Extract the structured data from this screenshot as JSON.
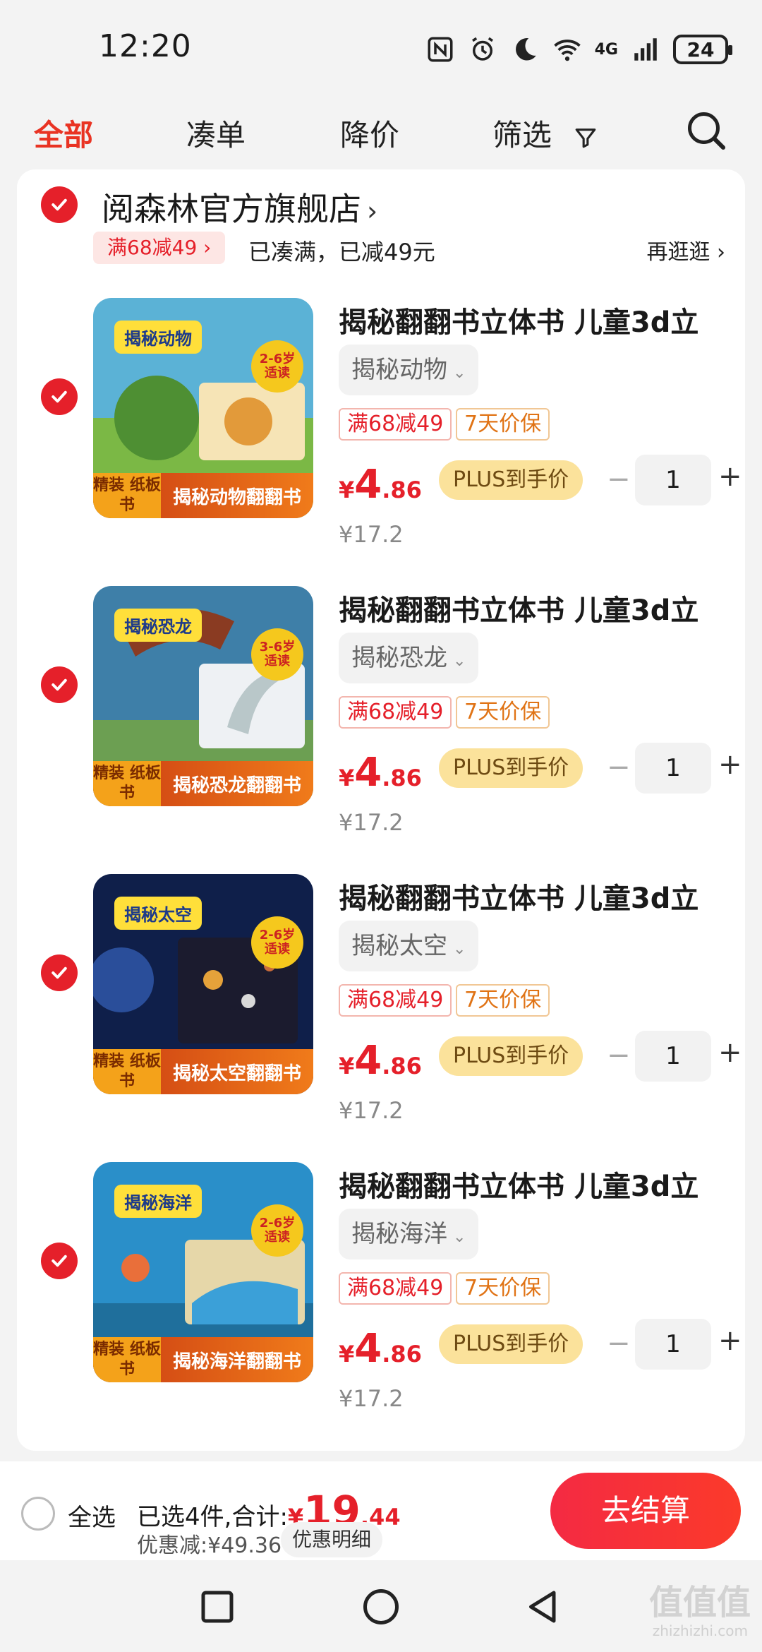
{
  "status_bar": {
    "time": "12:20",
    "network": "4G",
    "battery": "24"
  },
  "tabs": [
    {
      "label": "全部",
      "active": true
    },
    {
      "label": "凑单",
      "active": false
    },
    {
      "label": "降价",
      "active": false
    },
    {
      "label": "筛选",
      "active": false
    }
  ],
  "shop": {
    "name": "阅森林官方旗舰店",
    "promo_tag": "满68减49 ›",
    "promo_text": "已凑满，已减49元",
    "promo_more": "再逛逛 ›"
  },
  "items": [
    {
      "title": "揭秘翻翻书立体书 儿童3d立",
      "spec": "揭秘动物",
      "tag1": "满68减49",
      "tag2": "7天价保",
      "price_currency": "¥",
      "price_int": "4",
      "price_dec": ".86",
      "plus_label": "PLUS到手价",
      "quantity": "1",
      "original_price": "¥17.2",
      "thumb_title": "揭秘动物",
      "thumb_banner": "揭秘动物翻翻书",
      "thumb_badge": "精装 纸板书",
      "thumb_age": "2-6岁 适读",
      "thumb_color_bg": "#5bb2d6",
      "thumb_color_fg": "#4e8f33"
    },
    {
      "title": "揭秘翻翻书立体书 儿童3d立",
      "spec": "揭秘恐龙",
      "tag1": "满68减49",
      "tag2": "7天价保",
      "price_currency": "¥",
      "price_int": "4",
      "price_dec": ".86",
      "plus_label": "PLUS到手价",
      "quantity": "1",
      "original_price": "¥17.2",
      "thumb_title": "揭秘恐龙",
      "thumb_banner": "揭秘恐龙翻翻书",
      "thumb_badge": "精装 纸板书",
      "thumb_age": "3-6岁 适读",
      "thumb_color_bg": "#3e7fa8",
      "thumb_color_fg": "#8a3b22"
    },
    {
      "title": "揭秘翻翻书立体书 儿童3d立",
      "spec": "揭秘太空",
      "tag1": "满68减49",
      "tag2": "7天价保",
      "price_currency": "¥",
      "price_int": "4",
      "price_dec": ".86",
      "plus_label": "PLUS到手价",
      "quantity": "1",
      "original_price": "¥17.2",
      "thumb_title": "揭秘太空",
      "thumb_banner": "揭秘太空翻翻书",
      "thumb_badge": "精装 纸板书",
      "thumb_age": "2-6岁 适读",
      "thumb_color_bg": "#0f1f4a",
      "thumb_color_fg": "#2a4e9a"
    },
    {
      "title": "揭秘翻翻书立体书 儿童3d立",
      "spec": "揭秘海洋",
      "tag1": "满68减49",
      "tag2": "7天价保",
      "price_currency": "¥",
      "price_int": "4",
      "price_dec": ".86",
      "plus_label": "PLUS到手价",
      "quantity": "1",
      "original_price": "¥17.2",
      "thumb_title": "揭秘海洋",
      "thumb_banner": "揭秘海洋翻翻书",
      "thumb_badge": "精装 纸板书",
      "thumb_age": "2-6岁 适读",
      "thumb_color_bg": "#2a8fc9",
      "thumb_color_fg": "#e6d7a9"
    }
  ],
  "checkout": {
    "select_all": "全选",
    "summary": "已选4件,合计:",
    "total_currency": "¥",
    "total_int": "19",
    "total_dec": ".44",
    "discount": "优惠减:¥49.36",
    "detail_button": "优惠明细",
    "checkout_button": "去结算"
  },
  "watermark": {
    "text": "值值值",
    "sub": "zhizhizhi.com"
  },
  "colors": {
    "accent": "#e5202a",
    "plus_gold": "#fbe29b"
  }
}
